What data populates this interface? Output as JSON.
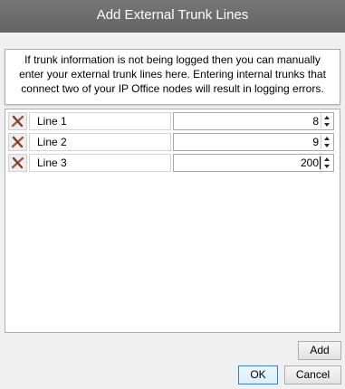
{
  "dialog": {
    "title": "Add External Trunk Lines",
    "info_text": "If trunk information is not being logged then you can manually enter your external trunk lines here. Entering internal trunks that connect two of your IP Office nodes will result in logging errors."
  },
  "lines": [
    {
      "label": "Line 1",
      "value": "8"
    },
    {
      "label": "Line 2",
      "value": "9"
    },
    {
      "label": "Line 3",
      "value": "200"
    }
  ],
  "buttons": {
    "add": "Add",
    "ok": "OK",
    "cancel": "Cancel"
  },
  "icons": {
    "delete": "delete-x-icon",
    "spin_up": "triangle-up-icon",
    "spin_down": "triangle-down-icon"
  },
  "colors": {
    "titlebar": "#6e6e6e",
    "delete_icon": "#a05a48",
    "ok_border": "#3c7fb1"
  }
}
